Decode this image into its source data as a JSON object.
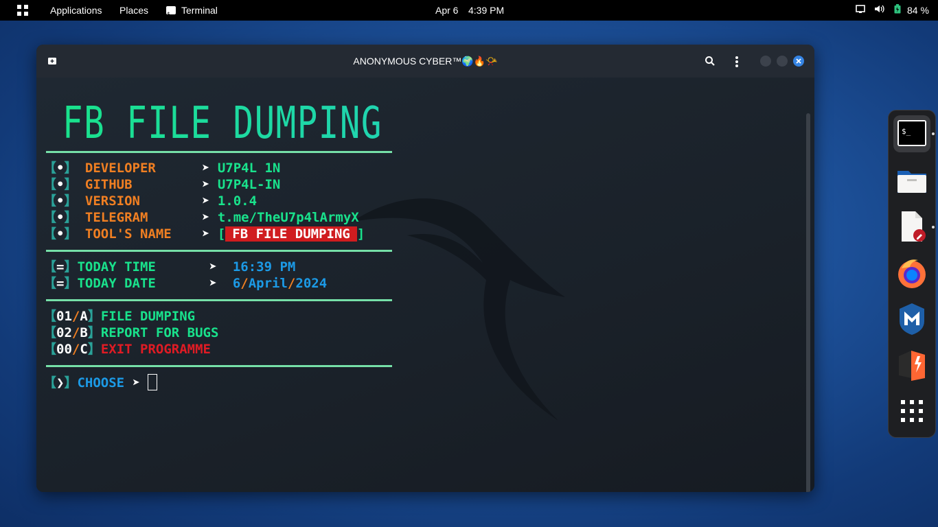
{
  "topbar": {
    "applications": "Applications",
    "places": "Places",
    "terminal": "Terminal",
    "date": "Apr 6",
    "time": "4:39 PM",
    "battery": "84 %"
  },
  "window": {
    "title": "ANONYMOUS CYBER™🌍🔥📯"
  },
  "terminal": {
    "banner": "FB FILE DUMPING",
    "info": [
      {
        "bullet": "•",
        "label": "DEVELOPER",
        "value": "U7P4L 1N"
      },
      {
        "bullet": "•",
        "label": "GITHUB",
        "value": "U7P4L-IN"
      },
      {
        "bullet": "•",
        "label": "VERSION",
        "value": "1.0.4"
      },
      {
        "bullet": "•",
        "label": "TELEGRAM",
        "value": "t.me/TheU7p4lArmyX"
      },
      {
        "bullet": "•",
        "label": "TOOL'S NAME",
        "value": "FB FILE DUMPING"
      }
    ],
    "time_label": "TODAY TIME",
    "time_value": "16:39 PM",
    "date_label": "TODAY DATE",
    "date_day": "6",
    "date_month": "April",
    "date_year": "2024",
    "menu": [
      {
        "num": "01",
        "key": "A",
        "label": "FILE DUMPING"
      },
      {
        "num": "02",
        "key": "B",
        "label": "REPORT FOR BUGS"
      },
      {
        "num": "00",
        "key": "C",
        "label": "EXIT PROGRAMME"
      }
    ],
    "prompt": "CHOOSE"
  },
  "dock": {
    "items": [
      "terminal-app",
      "files-app",
      "text-editor-app",
      "firefox-app",
      "metasploit-app",
      "burpsuite-app",
      "show-apps"
    ]
  },
  "colors": {
    "label": "#f07f22",
    "value": "#19e28c",
    "accent_blue": "#1c9ae6",
    "exit_red": "#e01b24",
    "bracket": "#2aa198"
  }
}
